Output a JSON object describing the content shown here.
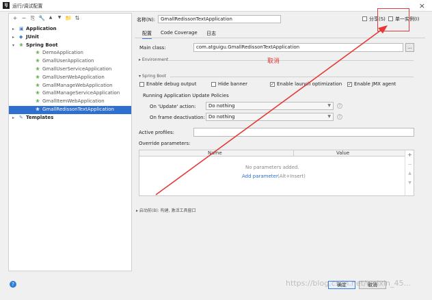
{
  "window": {
    "title": "运行/调试配置",
    "app_icon": "IJ"
  },
  "toolbar": {
    "add_label": "+",
    "remove_label": "−",
    "copy_label": "⎘",
    "wrench_label": "🔧",
    "up_label": "▲",
    "down_label": "▼",
    "folder_label": "📁",
    "sort_label": "⇅"
  },
  "tree": {
    "items": [
      {
        "label": "Application",
        "arrow": "▸",
        "icon": "▣",
        "bold": true
      },
      {
        "label": "JUnit",
        "arrow": "▸",
        "icon": "◆",
        "bold": true
      },
      {
        "label": "Spring Boot",
        "arrow": "▾",
        "icon": "❀",
        "bold": true
      },
      {
        "label": "DemoApplication",
        "icon": "❀"
      },
      {
        "label": "GmallUserApplication",
        "icon": "❀"
      },
      {
        "label": "GmallUserServiceApplication",
        "icon": "❀"
      },
      {
        "label": "GmallUserWebApplication",
        "icon": "❀"
      },
      {
        "label": "GmallManageWebApplication",
        "icon": "❀"
      },
      {
        "label": "GmallManageServiceApplication",
        "icon": "❀"
      },
      {
        "label": "GmallItemWebApplication",
        "icon": "❀"
      },
      {
        "label": "GmallRedissonTextApplication",
        "icon": "❀",
        "selected": true
      },
      {
        "label": "Templates",
        "arrow": "▸",
        "icon": "✎",
        "bold": true
      }
    ]
  },
  "form": {
    "name_label": "名称(N):",
    "name_value": "GmallRedissonTextApplication",
    "share_label": "分享(S)",
    "single_instance_label": "单一实例(I)",
    "tabs": [
      "配置",
      "Code Coverage",
      "日志"
    ],
    "main_class_label": "Main class:",
    "main_class_value": "com.atguigu.GmallRedissonTextApplication",
    "browse_label": "...",
    "environment_label": "Environment",
    "annotation": "取消",
    "spring_boot_label": "Spring Boot",
    "enable_debug_output": "Enable debug output",
    "hide_banner": "Hide banner",
    "enable_launch_optimization": "Enable launch optimization",
    "enable_jmx_agent": "Enable JMX agent",
    "check_mark": "✓",
    "running_update_policies": "Running Application Update Policies",
    "on_update_label": "On 'Update' action:",
    "on_update_value": "Do nothing",
    "on_frame_label": "On frame deactivation:",
    "on_frame_value": "Do nothing",
    "help_glyph": "?",
    "active_profiles_label": "Active profiles:",
    "override_params_label": "Override parameters:",
    "col_name": "Name",
    "col_value": "Value",
    "no_params": "No parameters added.",
    "add_parameter": "Add parameter",
    "add_parameter_shortcut": "(Alt+Insert)",
    "before_launch": "启动前(B): 构建, 激活工具窗口"
  },
  "buttons": {
    "ok": "确定",
    "cancel": "取消"
  },
  "watermark": "https://blog.csdn.net/weixin_45...",
  "colors": {
    "selection": "#2f6fd0",
    "accent": "#3d7bd9",
    "annotation_red": "#e53935"
  }
}
